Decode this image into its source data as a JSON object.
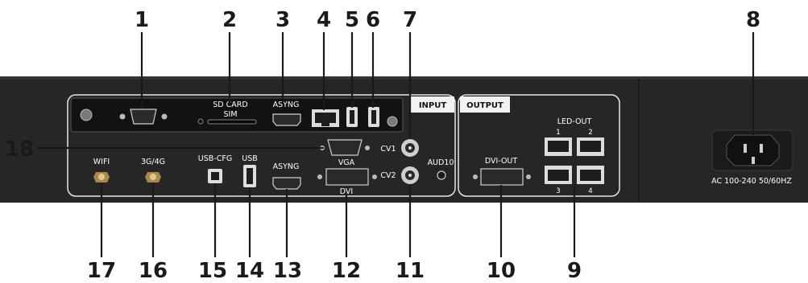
{
  "callouts": {
    "n1": "1",
    "n2": "2",
    "n3": "3",
    "n4": "4",
    "n5": "5",
    "n6": "6",
    "n7": "7",
    "n8": "8",
    "n9": "9",
    "n10": "10",
    "n11": "11",
    "n12": "12",
    "n13": "13",
    "n14": "14",
    "n15": "15",
    "n16": "16",
    "n17": "17",
    "n18": "18"
  },
  "panel_labels": {
    "sd_card": "SD CARD",
    "sim": "SIM",
    "async_top": "ASYNG",
    "input_tab": "INPUT",
    "output_tab": "OUTPUT",
    "led_out": "LED-OUT",
    "led_1": "1",
    "led_2": "2",
    "led_3": "3",
    "led_4": "4",
    "cv1": "CV1",
    "cv2": "CV2",
    "aud10": "AUD10",
    "vga": "VGA",
    "dvi": "DVI",
    "dvi_out": "DVI-OUT",
    "wifi": "WIFI",
    "g34": "3G/4G",
    "usb_cfg": "USB-CFG",
    "usb": "USB",
    "async_bottom": "ASYNG",
    "power": "AC 100-240 50/60HZ"
  }
}
